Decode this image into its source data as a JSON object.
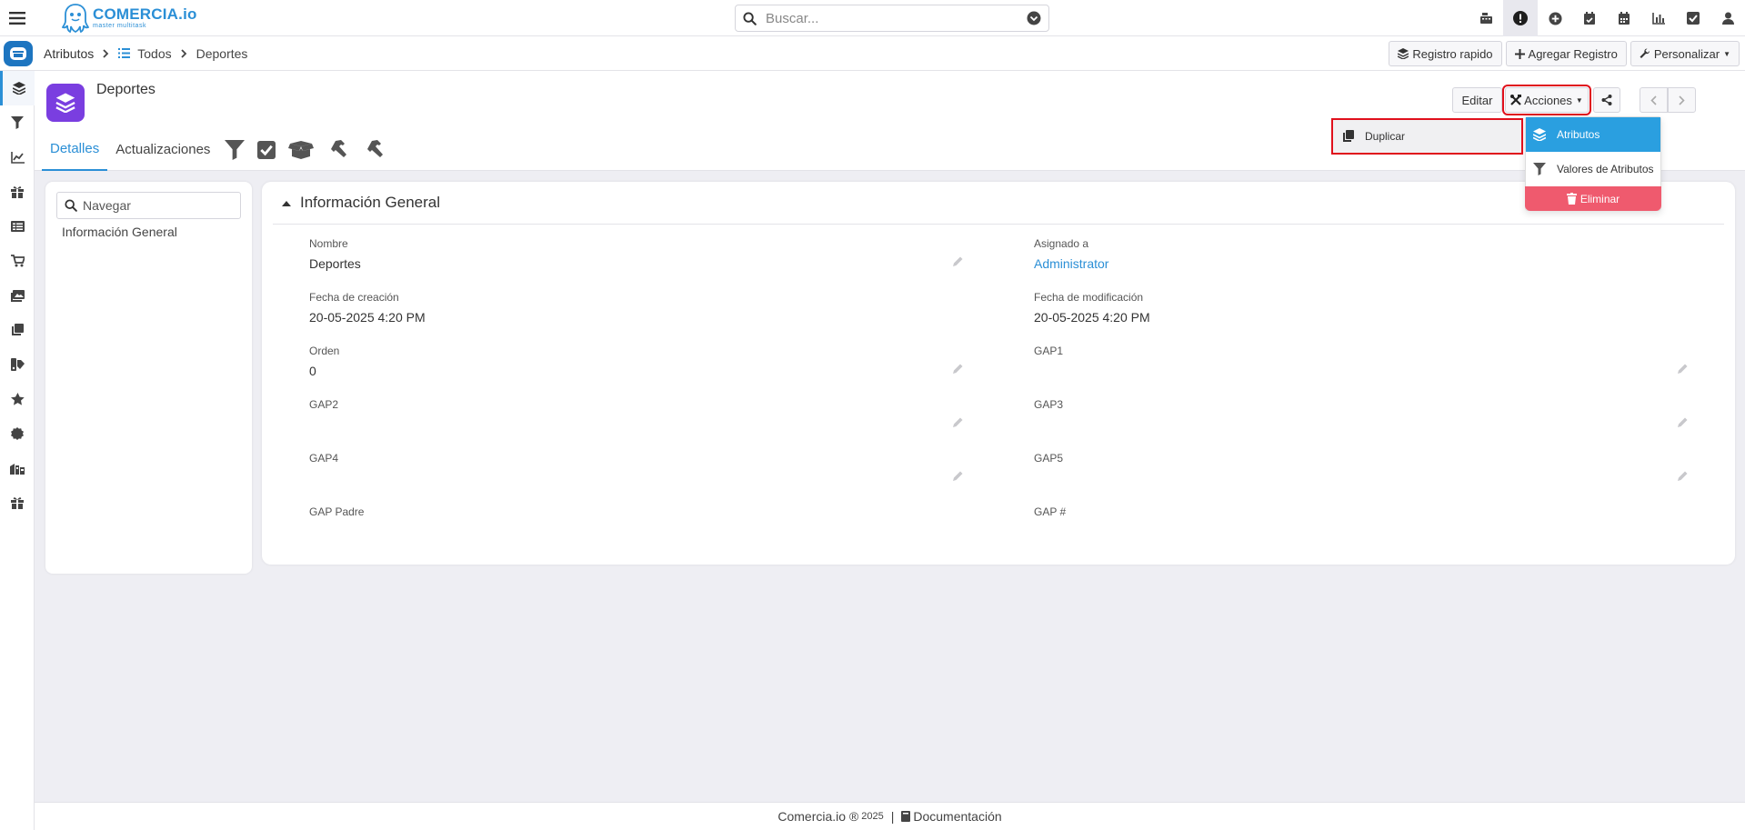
{
  "topbar": {
    "logo_name": "COMERCIA.io",
    "logo_tagline": "master multitask",
    "search_placeholder": "Buscar..."
  },
  "breadcrumb": {
    "module": "Atributos",
    "list": "Todos",
    "current": "Deportes"
  },
  "header_actions": {
    "quick_register": "Registro rapido",
    "add_record": "Agregar Registro",
    "customize": "Personalizar"
  },
  "record": {
    "title": "Deportes",
    "edit_label": "Editar",
    "actions_label": "Acciones"
  },
  "tabs": [
    {
      "label": "Detalles"
    },
    {
      "label": "Actualizaciones"
    }
  ],
  "dropdown": {
    "duplicate": "Duplicar",
    "items": [
      {
        "label": "Atributos"
      },
      {
        "label": "Valores de Atributos"
      },
      {
        "label": "Eliminar"
      }
    ]
  },
  "navigator": {
    "placeholder": "Navegar",
    "link": "Información General"
  },
  "panel": {
    "title": "Información General",
    "fields": [
      {
        "label": "Nombre",
        "value": "Deportes"
      },
      {
        "label": "Asignado a",
        "value": "Administrator"
      },
      {
        "label": "Fecha de creación",
        "value": "20-05-2025 4:20 PM"
      },
      {
        "label": "Fecha de modificación",
        "value": "20-05-2025 4:20 PM"
      },
      {
        "label": "Orden",
        "value": "0"
      },
      {
        "label": "GAP1",
        "value": ""
      },
      {
        "label": "GAP2",
        "value": ""
      },
      {
        "label": "GAP3",
        "value": ""
      },
      {
        "label": "GAP4",
        "value": ""
      },
      {
        "label": "GAP5",
        "value": ""
      },
      {
        "label": "GAP Padre",
        "value": ""
      },
      {
        "label": "GAP #",
        "value": ""
      }
    ]
  },
  "footer": {
    "brand": "Comercia.io ®",
    "year": "2025",
    "separator": "|",
    "docs": "Documentación"
  },
  "colors": {
    "accent": "#2b8fd6",
    "record_icon": "#7a3ee0",
    "danger": "#ef5a6e",
    "highlight": "#e0101c"
  }
}
